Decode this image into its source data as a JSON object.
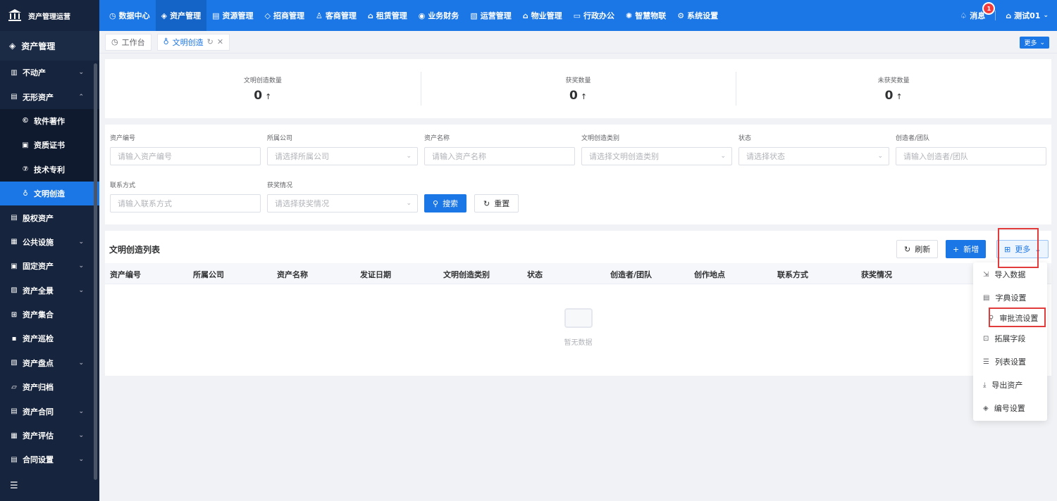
{
  "brand": {
    "title": "资产管理运营"
  },
  "topnav": [
    {
      "label": "数据中心",
      "icon": "dashboard-icon",
      "glyph": "◷",
      "active": false
    },
    {
      "label": "资产管理",
      "icon": "cube-icon",
      "glyph": "◈",
      "active": true
    },
    {
      "label": "资源管理",
      "icon": "building-icon",
      "glyph": "▤",
      "active": false
    },
    {
      "label": "招商管理",
      "icon": "tag-icon",
      "glyph": "◇",
      "active": false
    },
    {
      "label": "客商管理",
      "icon": "users-icon",
      "glyph": "♙",
      "active": false
    },
    {
      "label": "租赁管理",
      "icon": "house-icon",
      "glyph": "⌂",
      "active": false
    },
    {
      "label": "业务财务",
      "icon": "finance-icon",
      "glyph": "◉",
      "active": false
    },
    {
      "label": "运营管理",
      "icon": "operations-icon",
      "glyph": "▧",
      "active": false
    },
    {
      "label": "物业管理",
      "icon": "property-icon",
      "glyph": "⌂",
      "active": false
    },
    {
      "label": "行政办公",
      "icon": "office-icon",
      "glyph": "▭",
      "active": false
    },
    {
      "label": "智慧物联",
      "icon": "iot-icon",
      "glyph": "✺",
      "active": false
    },
    {
      "label": "系统设置",
      "icon": "settings-icon",
      "glyph": "⚙",
      "active": false
    }
  ],
  "topright": {
    "message_label": "消息",
    "message_count": "1",
    "user_label": "测试01"
  },
  "sidebar": {
    "header": "资产管理",
    "items": [
      {
        "label": "不动产",
        "icon": "building-icon",
        "glyph": "▥",
        "chevron": "⌄",
        "sub": false,
        "active": false
      },
      {
        "label": "无形资产",
        "icon": "document-icon",
        "glyph": "▤",
        "chevron": "⌃",
        "sub": false,
        "active": false
      },
      {
        "label": "软件著作",
        "icon": "copyright-icon",
        "glyph": "©",
        "chevron": "",
        "sub": true,
        "active": false
      },
      {
        "label": "资质证书",
        "icon": "certificate-icon",
        "glyph": "▣",
        "chevron": "",
        "sub": true,
        "active": false
      },
      {
        "label": "技术专利",
        "icon": "patent-icon",
        "glyph": "⑦",
        "chevron": "",
        "sub": true,
        "active": false
      },
      {
        "label": "文明创造",
        "icon": "pin-icon",
        "glyph": "♁",
        "chevron": "",
        "sub": true,
        "active": true
      },
      {
        "label": "股权资产",
        "icon": "equity-icon",
        "glyph": "▤",
        "chevron": "",
        "sub": false,
        "active": false
      },
      {
        "label": "公共设施",
        "icon": "facility-icon",
        "glyph": "▦",
        "chevron": "⌄",
        "sub": false,
        "active": false
      },
      {
        "label": "固定资产",
        "icon": "fixed-asset-icon",
        "glyph": "▣",
        "chevron": "⌄",
        "sub": false,
        "active": false
      },
      {
        "label": "资产全景",
        "icon": "panorama-icon",
        "glyph": "▨",
        "chevron": "⌄",
        "sub": false,
        "active": false
      },
      {
        "label": "资产集合",
        "icon": "grid-icon",
        "glyph": "⊞",
        "chevron": "",
        "sub": false,
        "active": false
      },
      {
        "label": "资产巡检",
        "icon": "inspection-icon",
        "glyph": "▪",
        "chevron": "",
        "sub": false,
        "active": false
      },
      {
        "label": "资产盘点",
        "icon": "inventory-icon",
        "glyph": "▧",
        "chevron": "⌄",
        "sub": false,
        "active": false
      },
      {
        "label": "资产归档",
        "icon": "archive-icon",
        "glyph": "▱",
        "chevron": "",
        "sub": false,
        "active": false
      },
      {
        "label": "资产合同",
        "icon": "contract-icon",
        "glyph": "▤",
        "chevron": "⌄",
        "sub": false,
        "active": false
      },
      {
        "label": "资产评估",
        "icon": "evaluation-icon",
        "glyph": "▦",
        "chevron": "⌄",
        "sub": false,
        "active": false
      },
      {
        "label": "合同设置",
        "icon": "contract-settings-icon",
        "glyph": "▤",
        "chevron": "⌄",
        "sub": false,
        "active": false
      }
    ]
  },
  "tabs": [
    {
      "label": "工作台",
      "active": false
    },
    {
      "label": "文明创造",
      "active": true
    }
  ],
  "tabbar_more": "更多",
  "stats": [
    {
      "label": "文明创造数量",
      "value": "0"
    },
    {
      "label": "获奖数量",
      "value": "0"
    },
    {
      "label": "未获奖数量",
      "value": "0"
    }
  ],
  "filter": {
    "asset_no": {
      "label": "资产编号",
      "placeholder": "请输入资产编号"
    },
    "company": {
      "label": "所属公司",
      "placeholder": "请选择所属公司"
    },
    "asset_name": {
      "label": "资产名称",
      "placeholder": "请输入资产名称"
    },
    "category": {
      "label": "文明创造类别",
      "placeholder": "请选择文明创造类别"
    },
    "status": {
      "label": "状态",
      "placeholder": "请选择状态"
    },
    "creator": {
      "label": "创造者/团队",
      "placeholder": "请输入创造者/团队"
    },
    "contact": {
      "label": "联系方式",
      "placeholder": "请输入联系方式"
    },
    "award": {
      "label": "获奖情况",
      "placeholder": "请选择获奖情况"
    },
    "search_label": "搜索",
    "reset_label": "重置"
  },
  "list": {
    "title": "文明创造列表",
    "refresh_label": "刷新",
    "add_label": "新增",
    "more_label": "更多",
    "columns": [
      "资产编号",
      "所属公司",
      "资产名称",
      "发证日期",
      "文明创造类别",
      "状态",
      "创造者/团队",
      "创作地点",
      "联系方式",
      "获奖情况"
    ],
    "empty_text": "暂无数据"
  },
  "dropdown": [
    {
      "label": "导入数据",
      "icon": "import-icon",
      "glyph": "⇲"
    },
    {
      "label": "字典设置",
      "icon": "dictionary-icon",
      "glyph": "▤"
    },
    {
      "label": "审批流设置",
      "icon": "workflow-icon",
      "glyph": "⚲"
    },
    {
      "label": "拓展字段",
      "icon": "extend-field-icon",
      "glyph": "⊡"
    },
    {
      "label": "列表设置",
      "icon": "list-settings-icon",
      "glyph": "☰"
    },
    {
      "label": "导出资产",
      "icon": "export-icon",
      "glyph": "⤓"
    },
    {
      "label": "编号设置",
      "icon": "tag-icon",
      "glyph": "◈"
    }
  ],
  "colors": {
    "primary": "#1b76e6",
    "sidebar": "#16243d",
    "highlight": "#e23b3b"
  }
}
